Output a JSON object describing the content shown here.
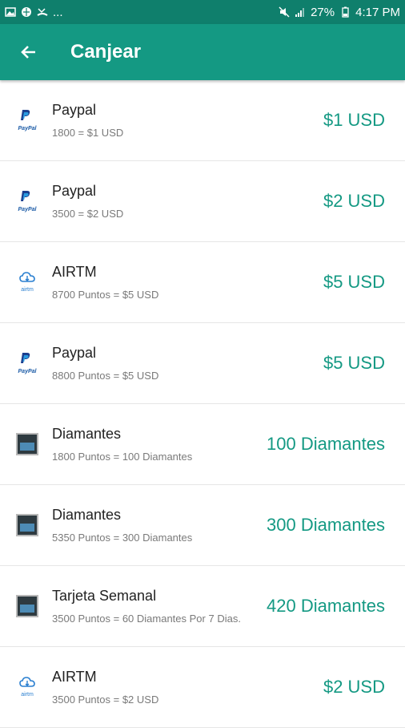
{
  "status_bar": {
    "battery": "27%",
    "time": "4:17 PM",
    "dots": "..."
  },
  "app_bar": {
    "title": "Canjear"
  },
  "colors": {
    "status_bar": "#0f7f6c",
    "app_bar": "#149983",
    "accent_text": "#149983"
  },
  "items": [
    {
      "icon": "paypal-icon",
      "title": "Paypal",
      "subtitle": "1800 = $1 USD",
      "value": "$1 USD"
    },
    {
      "icon": "paypal-icon",
      "title": "Paypal",
      "subtitle": "3500 = $2 USD",
      "value": "$2 USD"
    },
    {
      "icon": "airtm-icon",
      "title": "AIRTM",
      "subtitle": "8700 Puntos  = $5 USD",
      "value": "$5 USD"
    },
    {
      "icon": "paypal-icon",
      "title": "Paypal",
      "subtitle": "8800 Puntos = $5 USD",
      "value": "$5 USD"
    },
    {
      "icon": "game-icon",
      "title": "Diamantes",
      "subtitle": "1800 Puntos = 100 Diamantes",
      "value": "100 Diamantes"
    },
    {
      "icon": "game-icon",
      "title": "Diamantes",
      "subtitle": "5350 Puntos = 300 Diamantes",
      "value": "300 Diamantes"
    },
    {
      "icon": "game-card-icon",
      "title": "Tarjeta Semanal",
      "subtitle": "3500 Puntos = 60 Diamantes Por 7 Dias.",
      "value": "420 Diamantes"
    },
    {
      "icon": "airtm-icon",
      "title": "AIRTM",
      "subtitle": "3500 Puntos = $2 USD",
      "value": "$2 USD"
    }
  ]
}
